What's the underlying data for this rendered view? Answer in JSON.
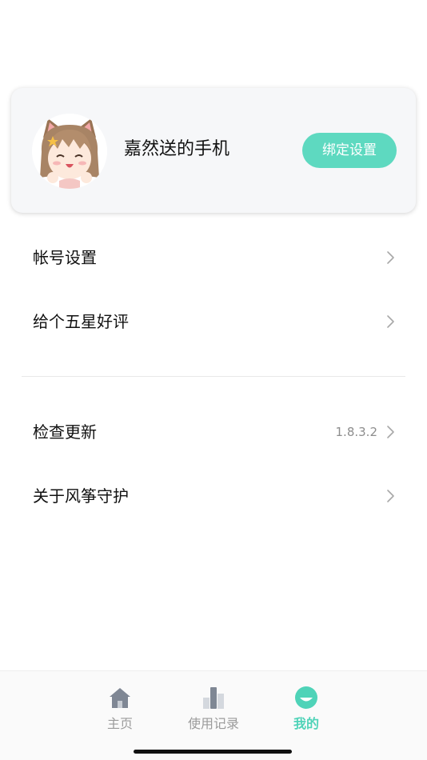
{
  "profile": {
    "device_name": "嘉然送的手机",
    "bind_button_label": "绑定设置",
    "avatar_icon": "anime-girl-avatar"
  },
  "menu": {
    "account_settings": {
      "label": "帐号设置",
      "icon": "chevron-right-icon"
    },
    "rate_five_stars": {
      "label": "给个五星好评",
      "icon": "chevron-right-icon"
    },
    "check_update": {
      "label": "检查更新",
      "value": "1.8.3.2",
      "icon": "chevron-right-icon"
    },
    "about": {
      "label": "关于风筝守护",
      "icon": "chevron-right-icon"
    }
  },
  "tabbar": {
    "tabs": [
      {
        "label": "主页",
        "icon": "home-icon",
        "active": false
      },
      {
        "label": "使用记录",
        "icon": "bar-chart-icon",
        "active": false
      },
      {
        "label": "我的",
        "icon": "smile-face-icon",
        "active": true
      }
    ]
  },
  "colors": {
    "accent": "#5ed9c0",
    "accent_text": "#4fd3b8",
    "inactive": "#9b9b9b"
  }
}
